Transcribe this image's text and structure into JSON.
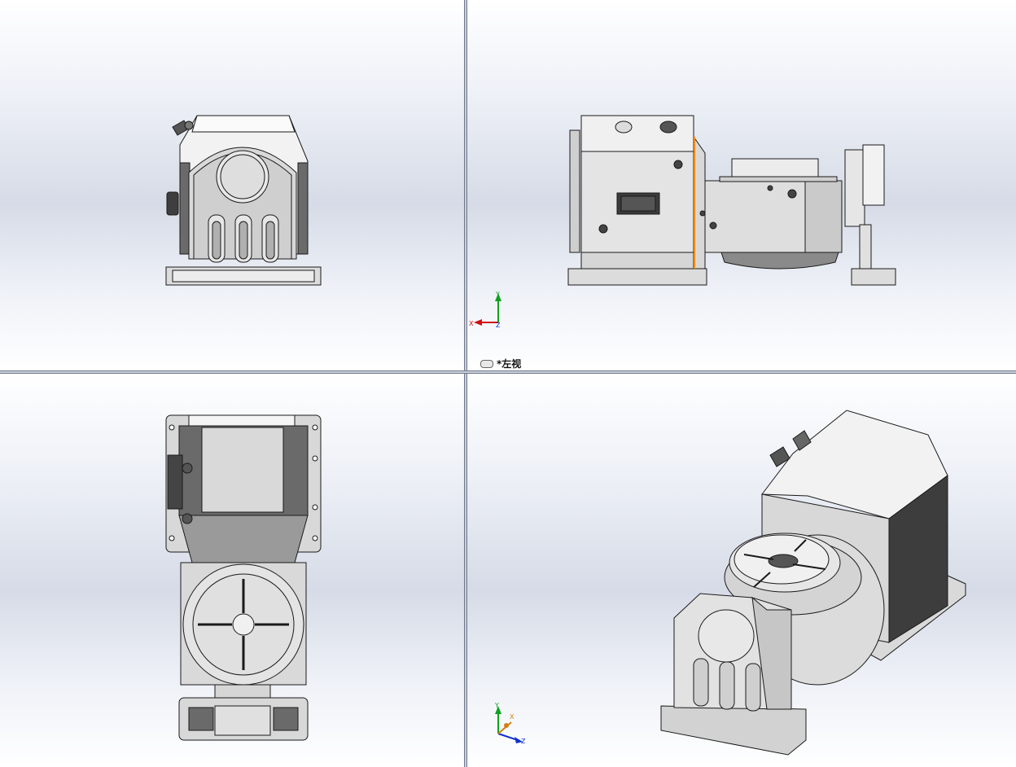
{
  "viewports": {
    "top_left": {
      "name": "front"
    },
    "top_right": {
      "name": "left",
      "label": "*左视"
    },
    "bottom_left": {
      "name": "top"
    },
    "bottom_right": {
      "name": "isometric"
    }
  },
  "triad": {
    "top_right": {
      "x": "X",
      "y": "Y",
      "z": "Z"
    },
    "bottom_right": {
      "x": "X",
      "y": "Y",
      "z": "Z"
    }
  },
  "colors": {
    "part_light": "#e6e6e6",
    "part_mid": "#bdbdbd",
    "part_dark": "#5a5a5a",
    "edge": "#1a1a1a",
    "highlight_edge": "#f08a00",
    "axis_x": "#d01010",
    "axis_y": "#10a020",
    "axis_z": "#1030d0"
  }
}
